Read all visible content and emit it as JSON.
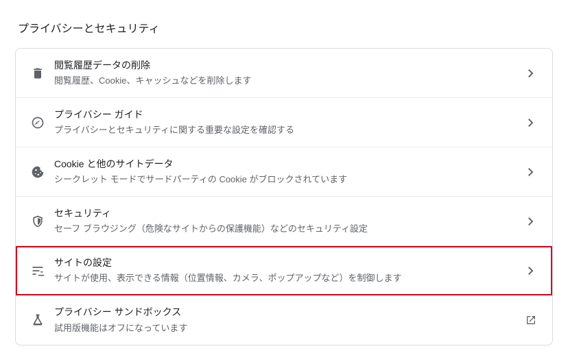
{
  "section_title": "プライバシーとセキュリティ",
  "items": [
    {
      "icon": "trash",
      "title": "閲覧履歴データの削除",
      "desc": "閲覧履歴、Cookie、キャッシュなどを削除します",
      "action": "chevron"
    },
    {
      "icon": "compass",
      "title": "プライバシー ガイド",
      "desc": "プライバシーとセキュリティに関する重要な設定を確認する",
      "action": "chevron"
    },
    {
      "icon": "cookie",
      "title": "Cookie と他のサイトデータ",
      "desc": "シークレット モードでサードパーティの Cookie がブロックされています",
      "action": "chevron"
    },
    {
      "icon": "shield",
      "title": "セキュリティ",
      "desc": "セーフ ブラウジング（危険なサイトからの保護機能）などのセキュリティ設定",
      "action": "chevron"
    },
    {
      "icon": "tune",
      "title": "サイトの設定",
      "desc": "サイトが使用、表示できる情報（位置情報、カメラ、ポップアップなど）を制御します",
      "action": "chevron",
      "highlighted": true
    },
    {
      "icon": "flask",
      "title": "プライバシー サンドボックス",
      "desc": "試用版機能はオフになっています",
      "action": "external"
    }
  ]
}
